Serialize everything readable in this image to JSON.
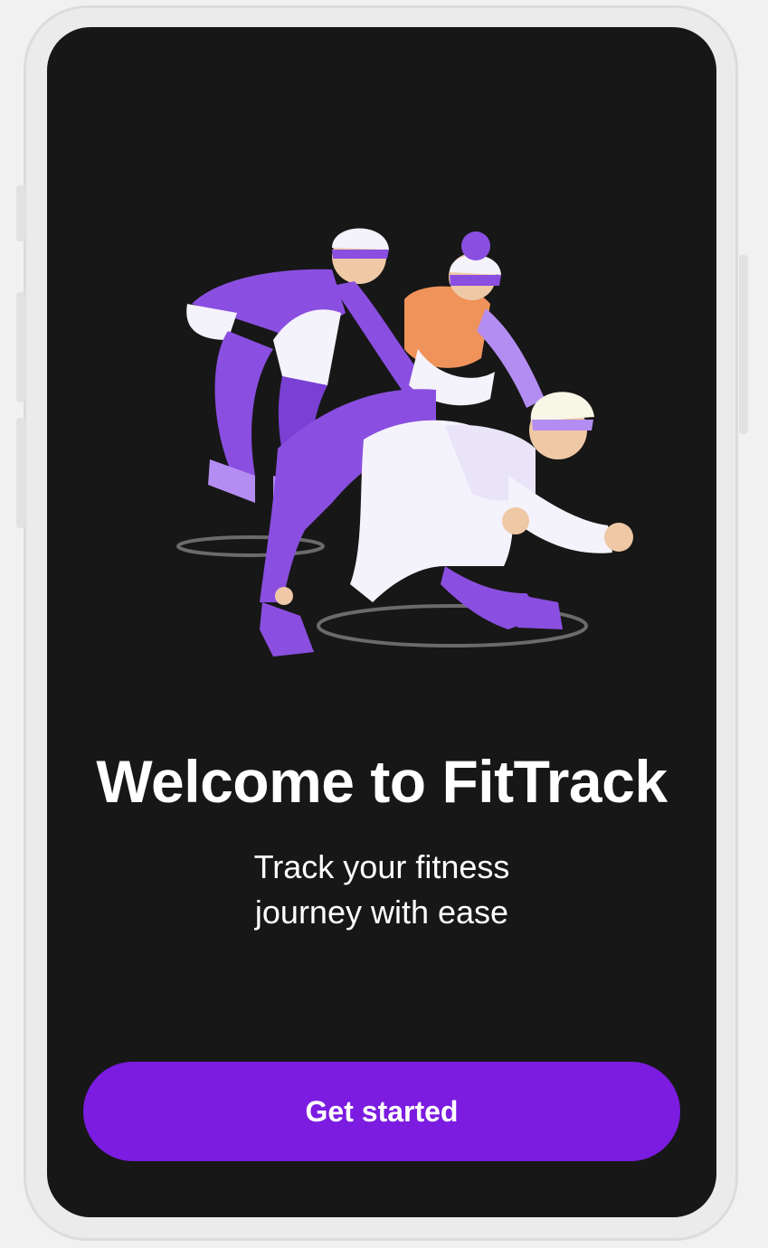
{
  "welcome": {
    "title": "Welcome to FitTrack",
    "subtitle_line1": "Track your fitness",
    "subtitle_line2": "journey with ease",
    "cta_label": "Get started",
    "illustration_icon": "group-exercise-illustration"
  },
  "colors": {
    "screen_background": "#171717",
    "accent": "#7b1ce0",
    "illustration_purple": "#8a4fe0",
    "illustration_orange": "#f0935a",
    "text": "#ffffff"
  }
}
